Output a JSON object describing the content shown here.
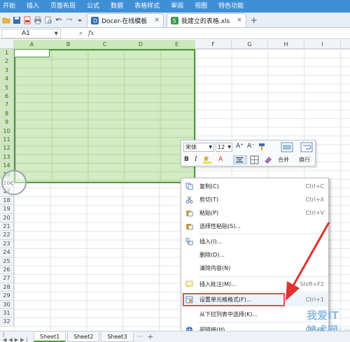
{
  "ribbon": {
    "items": [
      "开始",
      "插入",
      "页面布局",
      "公式",
      "数据",
      "表格样式",
      "审阅",
      "视图",
      "特色功能"
    ]
  },
  "tabs": [
    {
      "label": "Docer-在线模板",
      "close": "×"
    },
    {
      "label": "我建立的表格.xls",
      "close": "×"
    }
  ],
  "add_tab": "+",
  "formula_bar": {
    "cell_ref": "A1",
    "zoom_icon": "⌕",
    "fx": "fx"
  },
  "columns": [
    "A",
    "B",
    "C",
    "D",
    "E",
    "F",
    "G",
    "H",
    "I"
  ],
  "rows": [
    "1",
    "2",
    "3",
    "4",
    "5",
    "6",
    "7",
    "8",
    "9",
    "10",
    "11",
    "12",
    "13",
    "14",
    "15",
    "16",
    "17",
    "18",
    "19",
    "20",
    "21",
    "22",
    "23",
    "24",
    "25",
    "26",
    "27",
    "28",
    "29",
    "30",
    "31",
    "32"
  ],
  "mini_toolbar": {
    "font": "宋体",
    "size": "12",
    "grow": "A⁺",
    "shrink": "A⁻",
    "bold": "B",
    "italic": "I",
    "font_color": "A",
    "merge": "合并",
    "wrap": "换行"
  },
  "context_menu": [
    {
      "label": "复制(C)",
      "shortcut": "Ctrl+C"
    },
    {
      "label": "剪切(T)",
      "shortcut": "Ctrl+X"
    },
    {
      "label": "粘贴(P)",
      "shortcut": "Ctrl+V"
    },
    {
      "label": "选择性粘贴(S)...",
      "shortcut": ""
    },
    {
      "label": "插入(I)...",
      "shortcut": ""
    },
    {
      "label": "删除(D)...",
      "shortcut": ""
    },
    {
      "label": "清除内容(N)",
      "shortcut": ""
    },
    {
      "label": "插入批注(M)...",
      "shortcut": "Shift+F2"
    },
    {
      "label": "设置单元格格式(F)...",
      "shortcut": "Ctrl+1"
    },
    {
      "label": "从下拉列表中选择(K)...",
      "shortcut": ""
    },
    {
      "label": "超链接(H)...",
      "shortcut": "Ctrl+K"
    }
  ],
  "sheets": [
    "Sheet1",
    "Sheet2",
    "Sheet3"
  ],
  "sheet_more": "···",
  "sheet_add": "+",
  "watermark": {
    "title": "我爱IT技术网",
    "url": "www.52ij.com"
  },
  "colors": {
    "ribbon": "#3f8fd6",
    "selection": "#c6e6b0",
    "selection_border": "#4b9a3a",
    "highlight_box": "#e05050",
    "arrow": "#e0322f"
  }
}
